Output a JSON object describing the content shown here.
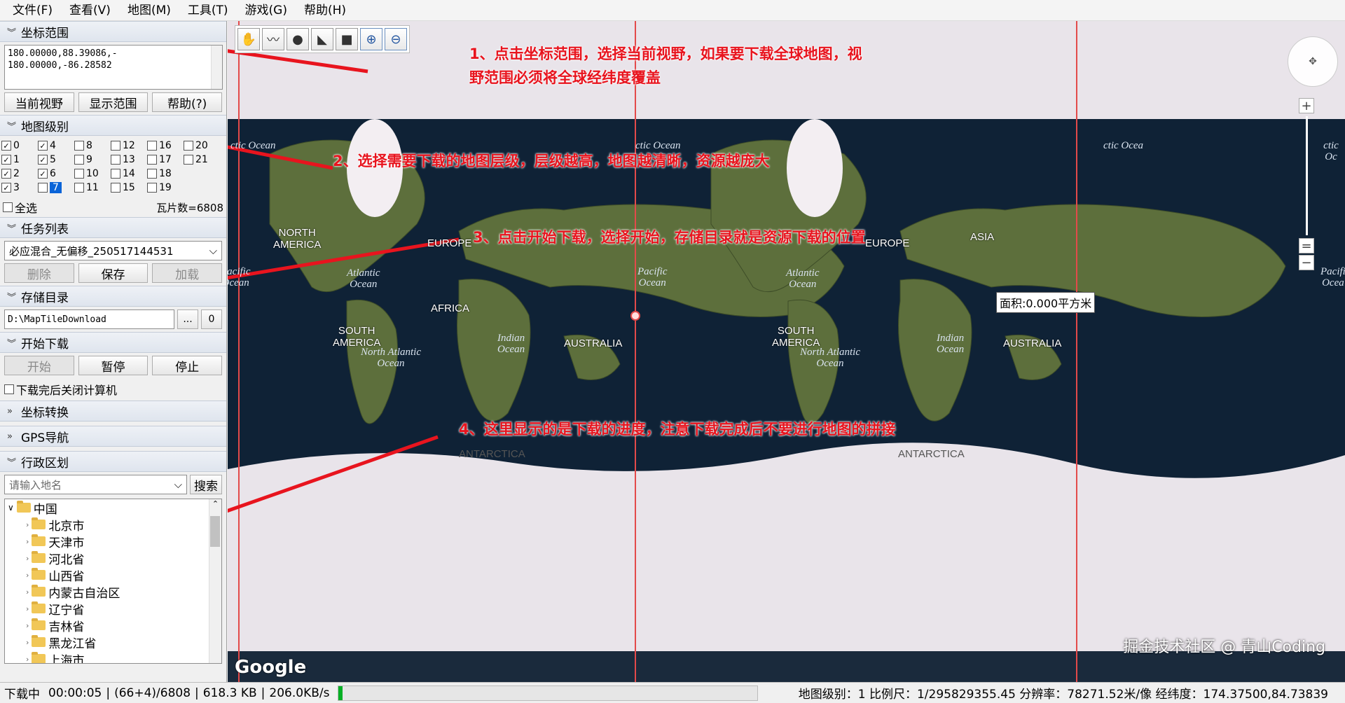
{
  "menu": [
    "文件(F)",
    "查看(V)",
    "地图(M)",
    "工具(T)",
    "游戏(G)",
    "帮助(H)"
  ],
  "coord_section": {
    "title": "坐标范围",
    "lines": [
      "180.00000,88.39086,-",
      "180.00000,-86.28582"
    ],
    "buttons": [
      "当前视野",
      "显示范围",
      "帮助(?)"
    ]
  },
  "level_section": {
    "title": "地图级别",
    "levels": [
      {
        "n": "0",
        "checked": true
      },
      {
        "n": "4",
        "checked": true
      },
      {
        "n": "8",
        "checked": false
      },
      {
        "n": "12",
        "checked": false
      },
      {
        "n": "16",
        "checked": false
      },
      {
        "n": "20",
        "checked": false
      },
      {
        "n": "1",
        "checked": true
      },
      {
        "n": "5",
        "checked": true
      },
      {
        "n": "9",
        "checked": false
      },
      {
        "n": "13",
        "checked": false
      },
      {
        "n": "17",
        "checked": false
      },
      {
        "n": "21",
        "checked": false
      },
      {
        "n": "2",
        "checked": true
      },
      {
        "n": "6",
        "checked": true
      },
      {
        "n": "10",
        "checked": false
      },
      {
        "n": "14",
        "checked": false
      },
      {
        "n": "18",
        "checked": false
      },
      {
        "n": "",
        "checked": false
      },
      {
        "n": "3",
        "checked": true
      },
      {
        "n": "7",
        "checked": false
      },
      {
        "n": "11",
        "checked": false
      },
      {
        "n": "15",
        "checked": false
      },
      {
        "n": "19",
        "checked": false
      },
      {
        "n": "",
        "checked": false
      }
    ],
    "select_all": "全选",
    "tile_count": "瓦片数=6808"
  },
  "task_section": {
    "title": "任务列表",
    "task": "必应混合_无偏移_250517144531",
    "buttons": [
      "删除",
      "保存",
      "加载"
    ]
  },
  "storage_section": {
    "title": "存储目录",
    "path": "D:\\MapTileDownload",
    "browse": "...",
    "zero": "0"
  },
  "download_section": {
    "title": "开始下载",
    "buttons": [
      "开始",
      "暂停",
      "停止"
    ],
    "shutdown": "下载完后关闭计算机"
  },
  "coord_convert": {
    "title": "坐标转换"
  },
  "gps": {
    "title": "GPS导航"
  },
  "admin_section": {
    "title": "行政区划",
    "placeholder": "请输入地名",
    "search": "搜索",
    "root": "中国",
    "provinces": [
      "北京市",
      "天津市",
      "河北省",
      "山西省",
      "内蒙古自治区",
      "辽宁省",
      "吉林省",
      "黑龙江省",
      "上海市"
    ]
  },
  "map": {
    "area_label": "面积:0.000平方米",
    "google": "Google",
    "places": [
      {
        "t": "NORTH\nAMERICA"
      },
      {
        "t": "EUROPE"
      },
      {
        "t": "AFRICA"
      },
      {
        "t": "SOUTH\nAMERICA"
      },
      {
        "t": "AUSTRALIA"
      },
      {
        "t": "ANTARCTICA"
      },
      {
        "t": "ASIA"
      },
      {
        "t": "EUROPE"
      },
      {
        "t": "SOUTH\nAMERICA"
      },
      {
        "t": "AUSTRALIA"
      },
      {
        "t": "ANTARCTICA"
      }
    ],
    "oceans": [
      {
        "t": "Atlantic\nOcean"
      },
      {
        "t": "Pacific\nOcean"
      },
      {
        "t": "Indian\nOcean"
      },
      {
        "t": "North Atlantic\nOcean"
      },
      {
        "t": "Pacific\nOcean"
      },
      {
        "t": "Atlantic\nOcean"
      },
      {
        "t": "Indian\nOcean"
      },
      {
        "t": "North Atlantic\nOcean"
      },
      {
        "t": "Pacifi\nOcea"
      },
      {
        "t": "ctic Ocean"
      },
      {
        "t": "ctic Ocean"
      },
      {
        "t": "ctic Ocea"
      },
      {
        "t": "ctic Oc"
      }
    ],
    "annotations": [
      "1、点击坐标范围，选择当前视野，如果要下载全球地图，视野范围必须将全球经纬度覆盖",
      "2、选择需要下载的地图层级，层级越高，地图越清晰，资源越庞大",
      "3、点击开始下载，选择开始，存储目录就是资源下载的位置",
      "4、这里显示的是下载的进度，注意下载完成后不要进行地图的拼接"
    ]
  },
  "status": {
    "state": "下载中",
    "time": "00:00:05",
    "tiles": "(66+4)/6808",
    "size": "618.3 KB",
    "speed": "206.0KB/s",
    "progress_fraction": 0.01,
    "right": "地图级别：1 比例尺：1/295829355.45 分辨率：78271.52米/像 经纬度：174.37500,84.73839"
  },
  "watermark": "掘金技术社区 @ 青山Coding",
  "colors": {
    "annotation": "#e8141e",
    "progress": "#06b025",
    "selection": "#0a64d8"
  }
}
